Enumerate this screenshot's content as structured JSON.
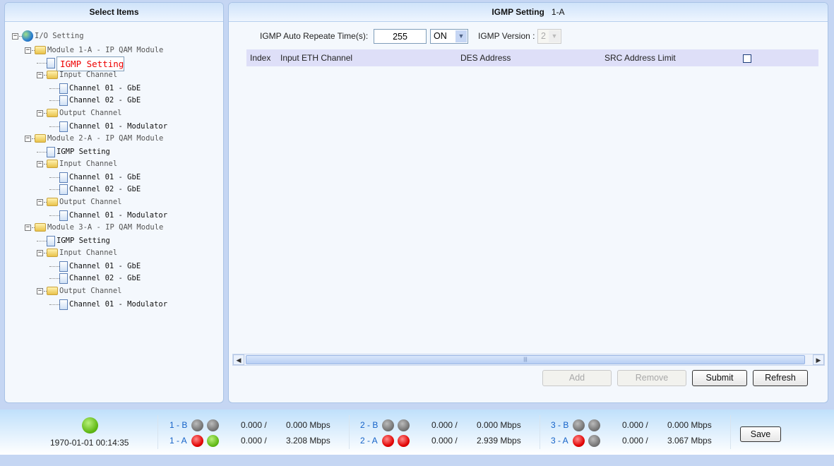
{
  "left_panel": {
    "title": "Select Items",
    "tree": [
      {
        "label": "I/O Setting",
        "level": 0,
        "icon": "globe",
        "toggle": "−",
        "state": "dim"
      },
      {
        "label": "Module 1-A - IP QAM Module",
        "level": 1,
        "icon": "folder",
        "toggle": "−",
        "state": "dim"
      },
      {
        "label": "IGMP Setting",
        "level": 2,
        "icon": "doc",
        "state": "selected"
      },
      {
        "label": "Input Channel",
        "level": 2,
        "icon": "folder",
        "toggle": "−",
        "state": "dim"
      },
      {
        "label": "Channel 01 - GbE",
        "level": 3,
        "icon": "doc"
      },
      {
        "label": "Channel 02 - GbE",
        "level": 3,
        "icon": "doc"
      },
      {
        "label": "Output Channel",
        "level": 2,
        "icon": "folder",
        "toggle": "−",
        "state": "dim"
      },
      {
        "label": "Channel 01 - Modulator",
        "level": 3,
        "icon": "doc"
      },
      {
        "label": "Module 2-A - IP QAM Module",
        "level": 1,
        "icon": "folder",
        "toggle": "−",
        "state": "dim"
      },
      {
        "label": "IGMP Setting",
        "level": 2,
        "icon": "doc"
      },
      {
        "label": "Input Channel",
        "level": 2,
        "icon": "folder",
        "toggle": "−",
        "state": "dim"
      },
      {
        "label": "Channel 01 - GbE",
        "level": 3,
        "icon": "doc"
      },
      {
        "label": "Channel 02 - GbE",
        "level": 3,
        "icon": "doc"
      },
      {
        "label": "Output Channel",
        "level": 2,
        "icon": "folder",
        "toggle": "−",
        "state": "dim"
      },
      {
        "label": "Channel 01 - Modulator",
        "level": 3,
        "icon": "doc"
      },
      {
        "label": "Module 3-A - IP QAM Module",
        "level": 1,
        "icon": "folder",
        "toggle": "−",
        "state": "dim"
      },
      {
        "label": "IGMP Setting",
        "level": 2,
        "icon": "doc"
      },
      {
        "label": "Input Channel",
        "level": 2,
        "icon": "folder",
        "toggle": "−",
        "state": "dim"
      },
      {
        "label": "Channel 01 - GbE",
        "level": 3,
        "icon": "doc"
      },
      {
        "label": "Channel 02 - GbE",
        "level": 3,
        "icon": "doc"
      },
      {
        "label": "Output Channel",
        "level": 2,
        "icon": "folder",
        "toggle": "−",
        "state": "dim"
      },
      {
        "label": "Channel 01 - Modulator",
        "level": 3,
        "icon": "doc"
      }
    ]
  },
  "right_panel": {
    "title": "IGMP Setting",
    "module": "1-A",
    "repeat_label": "IGMP Auto Repeate Time(s):",
    "repeat_value": "255",
    "repeat_mode": "ON",
    "version_label": "IGMP Version :",
    "version_value": "2",
    "columns": [
      "Index",
      "Input ETH Channel",
      "DES Address",
      "SRC Address Limit"
    ],
    "buttons": {
      "add": "Add",
      "remove": "Remove",
      "submit": "Submit",
      "refresh": "Refresh"
    }
  },
  "footer": {
    "status": "green",
    "datetime": "1970-01-01 00:14:35",
    "groups": [
      {
        "rows": [
          {
            "label": "1 - B",
            "leds": [
              "gray",
              "gray"
            ],
            "in": "0.000 /",
            "out": "0.000 Mbps"
          },
          {
            "label": "1 - A",
            "leds": [
              "red",
              "green"
            ],
            "in": "0.000 /",
            "out": "3.208 Mbps"
          }
        ]
      },
      {
        "rows": [
          {
            "label": "2 - B",
            "leds": [
              "gray",
              "gray"
            ],
            "in": "0.000 /",
            "out": "0.000 Mbps"
          },
          {
            "label": "2 - A",
            "leds": [
              "red",
              "red"
            ],
            "in": "0.000 /",
            "out": "2.939 Mbps"
          }
        ]
      },
      {
        "rows": [
          {
            "label": "3 - B",
            "leds": [
              "gray",
              "gray"
            ],
            "in": "0.000 /",
            "out": "0.000 Mbps"
          },
          {
            "label": "3 - A",
            "leds": [
              "red",
              "gray"
            ],
            "in": "0.000 /",
            "out": "3.067 Mbps"
          }
        ]
      }
    ],
    "save": "Save"
  }
}
